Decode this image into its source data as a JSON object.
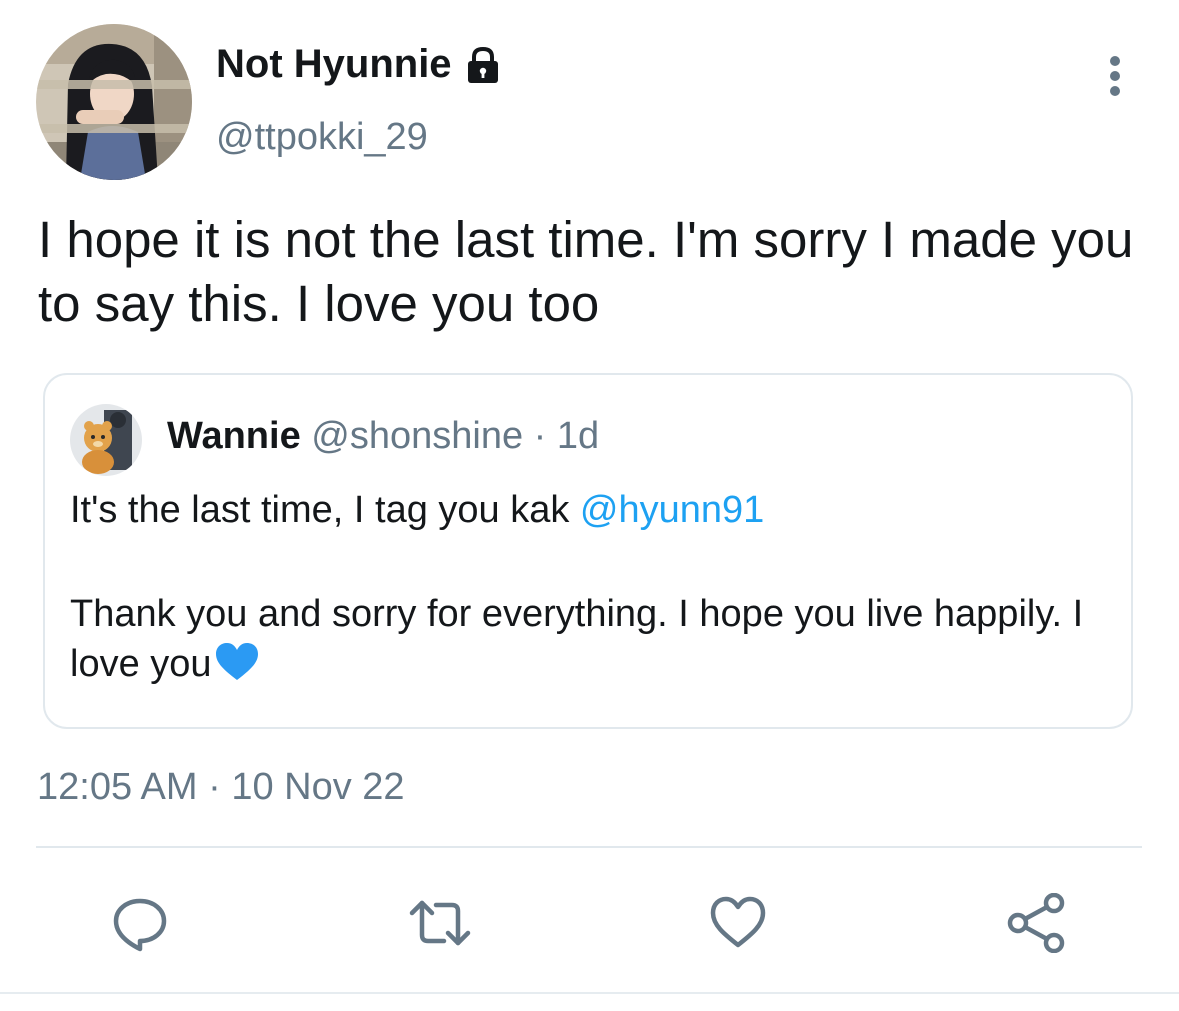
{
  "tweet": {
    "author": {
      "display_name": "Not Hyunnie",
      "handle": "@ttpokki_29",
      "locked_icon": "lock-icon"
    },
    "text": "I hope it is not the last time. I'm sorry I made you to say this. I love you too",
    "timestamp": "12:05 AM · 10 Nov 22"
  },
  "quoted_tweet": {
    "name": "Wannie",
    "handle": "@shonshine",
    "separator": "·",
    "time": "1d",
    "line1_text": "It's the last time, I tag you kak ",
    "mention": "@hyunn91",
    "line2_text": "Thank you and sorry for everything. I hope you live happily. I love you",
    "emoji_icon": "blue-heart-icon"
  },
  "actions": [
    "reply-icon",
    "retweet-icon",
    "like-icon",
    "share-icon"
  ],
  "colors": {
    "text": "#14171a",
    "secondary": "#657786",
    "link": "#1da1f2",
    "border": "#e1e8ed",
    "heart": "#2b9af3"
  }
}
